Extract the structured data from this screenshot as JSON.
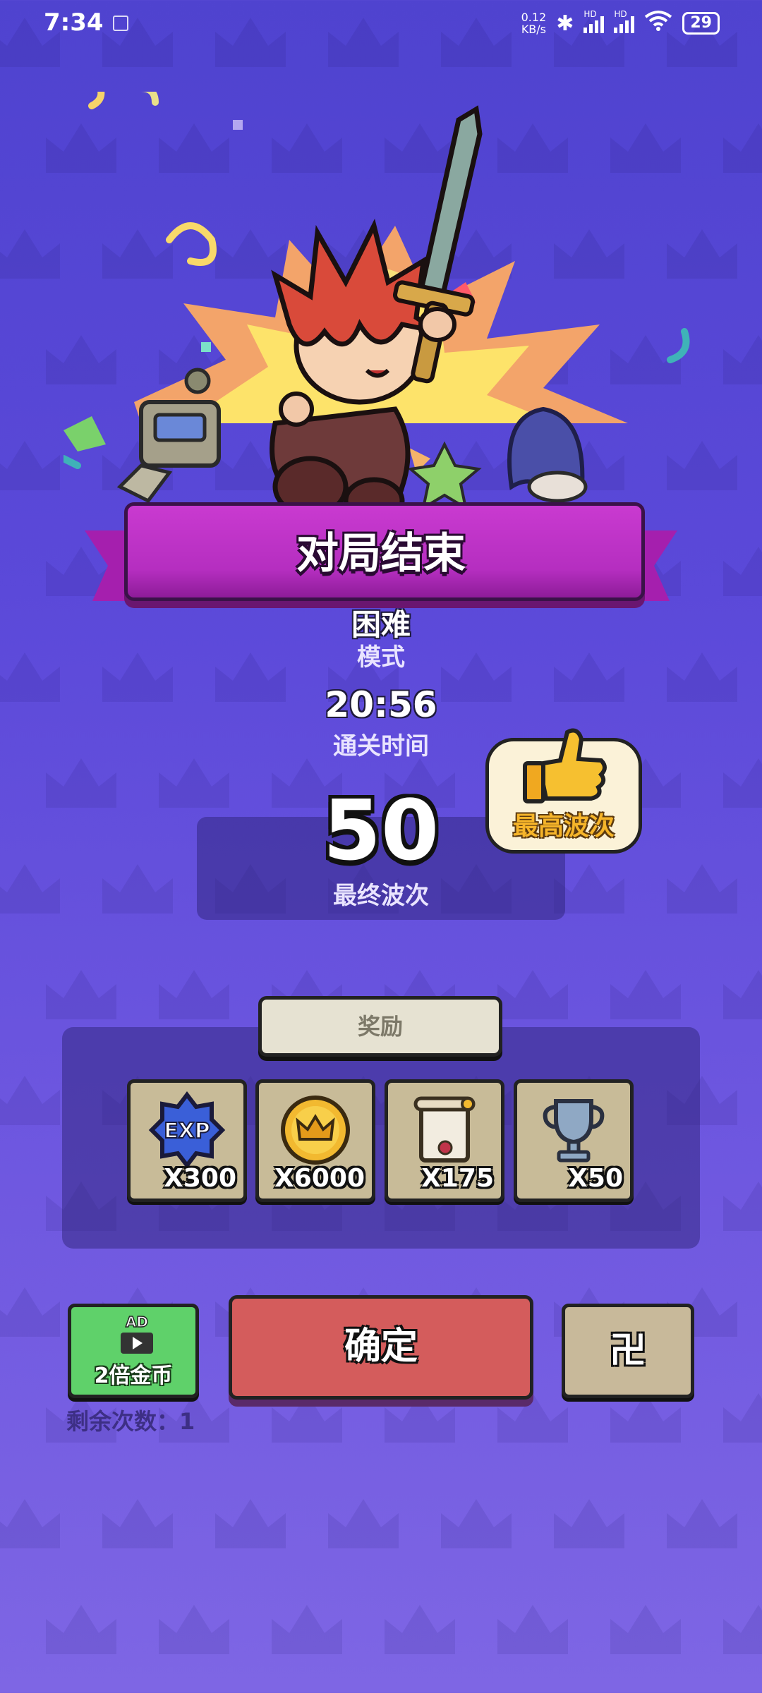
{
  "status_bar": {
    "time": "7:34",
    "net_speed_value": "0.12",
    "net_speed_unit": "KB/s",
    "hd1": "HD",
    "hd2": "HD",
    "battery": "29"
  },
  "result": {
    "title": "对局结束",
    "mode_value": "困难",
    "mode_label": "模式",
    "clear_time": "20:56",
    "clear_time_label": "通关时间",
    "final_wave": "50",
    "final_wave_label": "最终波次",
    "best_wave_badge": "最高波次"
  },
  "rewards": {
    "tab_label": "奖励",
    "items": [
      {
        "icon": "exp-icon",
        "exp_text": "EXP",
        "qty": "X300"
      },
      {
        "icon": "gold-coin-icon",
        "qty": "X6000"
      },
      {
        "icon": "scroll-icon",
        "qty": "X175"
      },
      {
        "icon": "trophy-icon",
        "qty": "X50"
      }
    ]
  },
  "actions": {
    "ad_icon_text": "AD",
    "ad_button_label": "2倍金币",
    "remaining_label": "剩余次数：1",
    "confirm_label": "确定",
    "share_label": "卍"
  },
  "colors": {
    "background": "#5b49d9",
    "banner": "#b52ec0",
    "confirm": "#d45c5c",
    "ad_button": "#5fd16a",
    "slot": "#c8bb98"
  }
}
